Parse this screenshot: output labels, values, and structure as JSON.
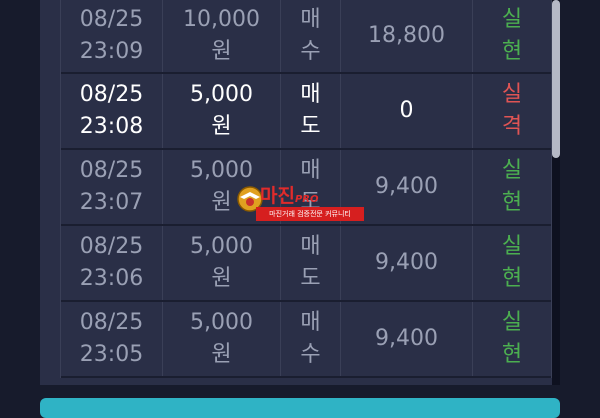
{
  "trades": [
    {
      "time_date": "08/25",
      "time_clock": "23:09",
      "amount_value": "10,000",
      "amount_unit": "원",
      "type_1": "매",
      "type_2": "수",
      "pnl": "18,800",
      "result_1": "실",
      "result_2": "현",
      "result_status": "ok",
      "highlight": false
    },
    {
      "time_date": "08/25",
      "time_clock": "23:08",
      "amount_value": "5,000",
      "amount_unit": "원",
      "type_1": "매",
      "type_2": "도",
      "pnl": "0",
      "result_1": "실",
      "result_2": "격",
      "result_status": "fail",
      "highlight": true
    },
    {
      "time_date": "08/25",
      "time_clock": "23:07",
      "amount_value": "5,000",
      "amount_unit": "원",
      "type_1": "매",
      "type_2": "도",
      "pnl": "9,400",
      "result_1": "실",
      "result_2": "현",
      "result_status": "ok",
      "highlight": false
    },
    {
      "time_date": "08/25",
      "time_clock": "23:06",
      "amount_value": "5,000",
      "amount_unit": "원",
      "type_1": "매",
      "type_2": "도",
      "pnl": "9,400",
      "result_1": "실",
      "result_2": "현",
      "result_status": "ok",
      "highlight": false
    },
    {
      "time_date": "08/25",
      "time_clock": "23:05",
      "amount_value": "5,000",
      "amount_unit": "원",
      "type_1": "매",
      "type_2": "수",
      "pnl": "9,400",
      "result_1": "실",
      "result_2": "현",
      "result_status": "ok",
      "highlight": false
    }
  ],
  "watermark": {
    "title": "마진",
    "title_suffix": "PRO",
    "subtitle": "마진거래 검증전문 커뮤니티"
  },
  "colors": {
    "success": "#4caf50",
    "fail": "#e05454",
    "accent_bar": "#2fb3c5"
  }
}
